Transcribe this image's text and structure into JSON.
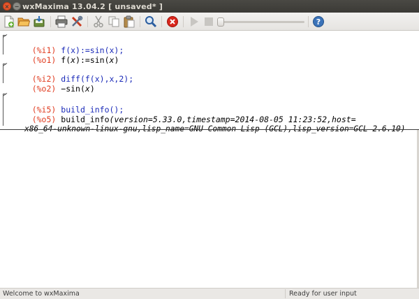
{
  "window": {
    "title": "wxMaxima 13.04.2 [ unsaved* ]",
    "close_glyph": "×",
    "minimize_glyph": "−"
  },
  "toolbar": {
    "icons": [
      "new-document-icon",
      "open-folder-icon",
      "save-icon",
      "print-icon",
      "preferences-icon",
      "cut-icon",
      "copy-icon",
      "paste-icon",
      "find-icon",
      "interrupt-icon",
      "play-icon",
      "stop-icon",
      "animation-slider",
      "help-icon"
    ],
    "accent_colors": {
      "interrupt": "#d9261c",
      "help": "#3b73b9",
      "find": "#2a5d9f"
    }
  },
  "cells": [
    {
      "input_label": "(%i1)",
      "input": "f(x):=sin(x);",
      "output_label": "(%o1)",
      "output_parts": [
        "f(",
        "x",
        "):=sin(",
        "x",
        ")"
      ]
    },
    {
      "input_label": "(%i2)",
      "input": "diff(f(x),x,2);",
      "output_label": "(%o2)",
      "output_parts": [
        "−sin(",
        "x",
        ")"
      ]
    },
    {
      "input_label": "(%i5)",
      "input": "build_info();",
      "output_label": "(%o5)",
      "output_line1": "build_info(version=5.33.0,timestamp=2014-08-05 11:23:52,host=",
      "output_line2": "x86_64-unknown-linux-gnu,lisp_name=GNU Common Lisp (GCL),lisp_version=GCL 2.6.10)"
    }
  ],
  "status": {
    "left": "Welcome to wxMaxima",
    "right": "Ready for user input"
  }
}
